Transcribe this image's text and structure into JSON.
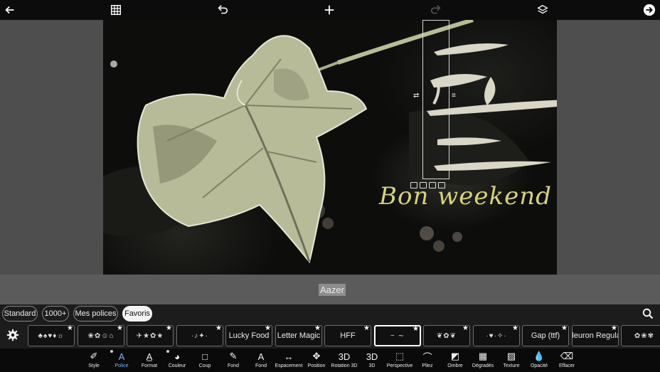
{
  "topbar": {
    "icons": [
      "back-arrow-icon",
      "grid-icon",
      "undo-icon",
      "add-icon",
      "redo-icon",
      "layers-icon",
      "next-arrow-icon"
    ]
  },
  "canvas": {
    "headline_text": "Bon weekend !",
    "colors": {
      "headline": "#d8d27a",
      "brush": "#d9d6c6",
      "leaf": "#cfd3b2"
    }
  },
  "text_input": {
    "value": "Aazer"
  },
  "font_tabs": [
    {
      "label": "Standard",
      "active": false
    },
    {
      "label": "1000+",
      "active": false
    },
    {
      "label": "Mes polices",
      "active": false
    },
    {
      "label": "Favoris",
      "active": true
    }
  ],
  "font_cards": [
    {
      "preview": "♣♠♥♦☼",
      "kind": "symbol"
    },
    {
      "preview": "❀✿☺⌂",
      "kind": "symbol"
    },
    {
      "preview": "✈★✿★",
      "kind": "symbol"
    },
    {
      "preview": "·♪✦·",
      "kind": "symbol"
    },
    {
      "preview": "Lucky Food",
      "kind": "text"
    },
    {
      "preview": "Letter Magic",
      "kind": "text"
    },
    {
      "preview": "HFF",
      "kind": "text"
    },
    {
      "preview": "~ ∼",
      "kind": "selected"
    },
    {
      "preview": "❦✿❦",
      "kind": "symbol"
    },
    {
      "preview": "·♥·✧·",
      "kind": "symbol"
    },
    {
      "preview": "Gap (ttf)",
      "kind": "text"
    },
    {
      "preview": "Fleuron Regular",
      "kind": "text"
    },
    {
      "preview": "✿❀✾",
      "kind": "symbol"
    }
  ],
  "tools": [
    {
      "label": "Style",
      "icon": "style-icon"
    },
    {
      "label": "Police",
      "icon": "font-icon",
      "active": true
    },
    {
      "label": "Format",
      "icon": "format-icon"
    },
    {
      "label": "Couleur",
      "icon": "palette-icon"
    },
    {
      "label": "Coup",
      "icon": "stroke-icon"
    },
    {
      "label": "Fond",
      "icon": "pen-icon"
    },
    {
      "label": "Fond",
      "icon": "text-background-icon"
    },
    {
      "label": "Espacement",
      "icon": "spacing-icon"
    },
    {
      "label": "Position",
      "icon": "move-icon"
    },
    {
      "label": "Rotation 3D",
      "icon": "rotation-3d-icon"
    },
    {
      "label": "3D",
      "icon": "3d-icon"
    },
    {
      "label": "Perspective",
      "icon": "perspective-icon"
    },
    {
      "label": "Pliez",
      "icon": "bend-icon"
    },
    {
      "label": "Ombre",
      "icon": "shadow-icon"
    },
    {
      "label": "Dégradés",
      "icon": "gradient-icon"
    },
    {
      "label": "Texture",
      "icon": "texture-icon"
    },
    {
      "label": "Opacité",
      "icon": "opacity-icon"
    },
    {
      "label": "Effacer",
      "icon": "eraser-icon"
    }
  ],
  "tool_glyphs": {
    "style": "✐",
    "font": "A",
    "format": "A̲",
    "palette": "◕",
    "stroke": "□",
    "pen": "✎",
    "textbg": "A",
    "spacing": "↔",
    "move": "✥",
    "rot3d": "3D",
    "d3": "3D",
    "persp": "⬚",
    "bend": "⌒",
    "shadow": "◩",
    "gradient": "▦",
    "texture": "▨",
    "opacity": "💧",
    "eraser": "⌫"
  }
}
